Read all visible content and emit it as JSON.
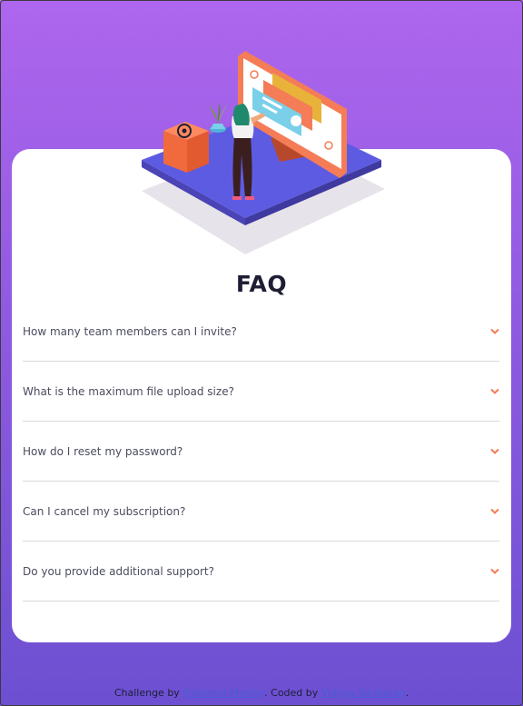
{
  "faq": {
    "title": "FAQ",
    "items": [
      {
        "question": "How many team members can I invite?"
      },
      {
        "question": "What is the maximum file upload size?"
      },
      {
        "question": "How do I reset my password?"
      },
      {
        "question": "Can I cancel my subscription?"
      },
      {
        "question": "Do you provide additional support?"
      }
    ]
  },
  "footer": {
    "prefix": "Challenge by",
    "link1": "Frontend Mentor",
    "middle": ". Coded by",
    "link2": "Vidhya Sankaran",
    "suffix": "."
  },
  "colors": {
    "bg_top": "#ae66ee",
    "bg_bottom": "#6c50d1",
    "accent": "#f47c57",
    "title": "#1d1e35",
    "divider": "#d9d9df"
  },
  "icons": [
    "chevron-down-icon",
    "at-sign-icon"
  ]
}
